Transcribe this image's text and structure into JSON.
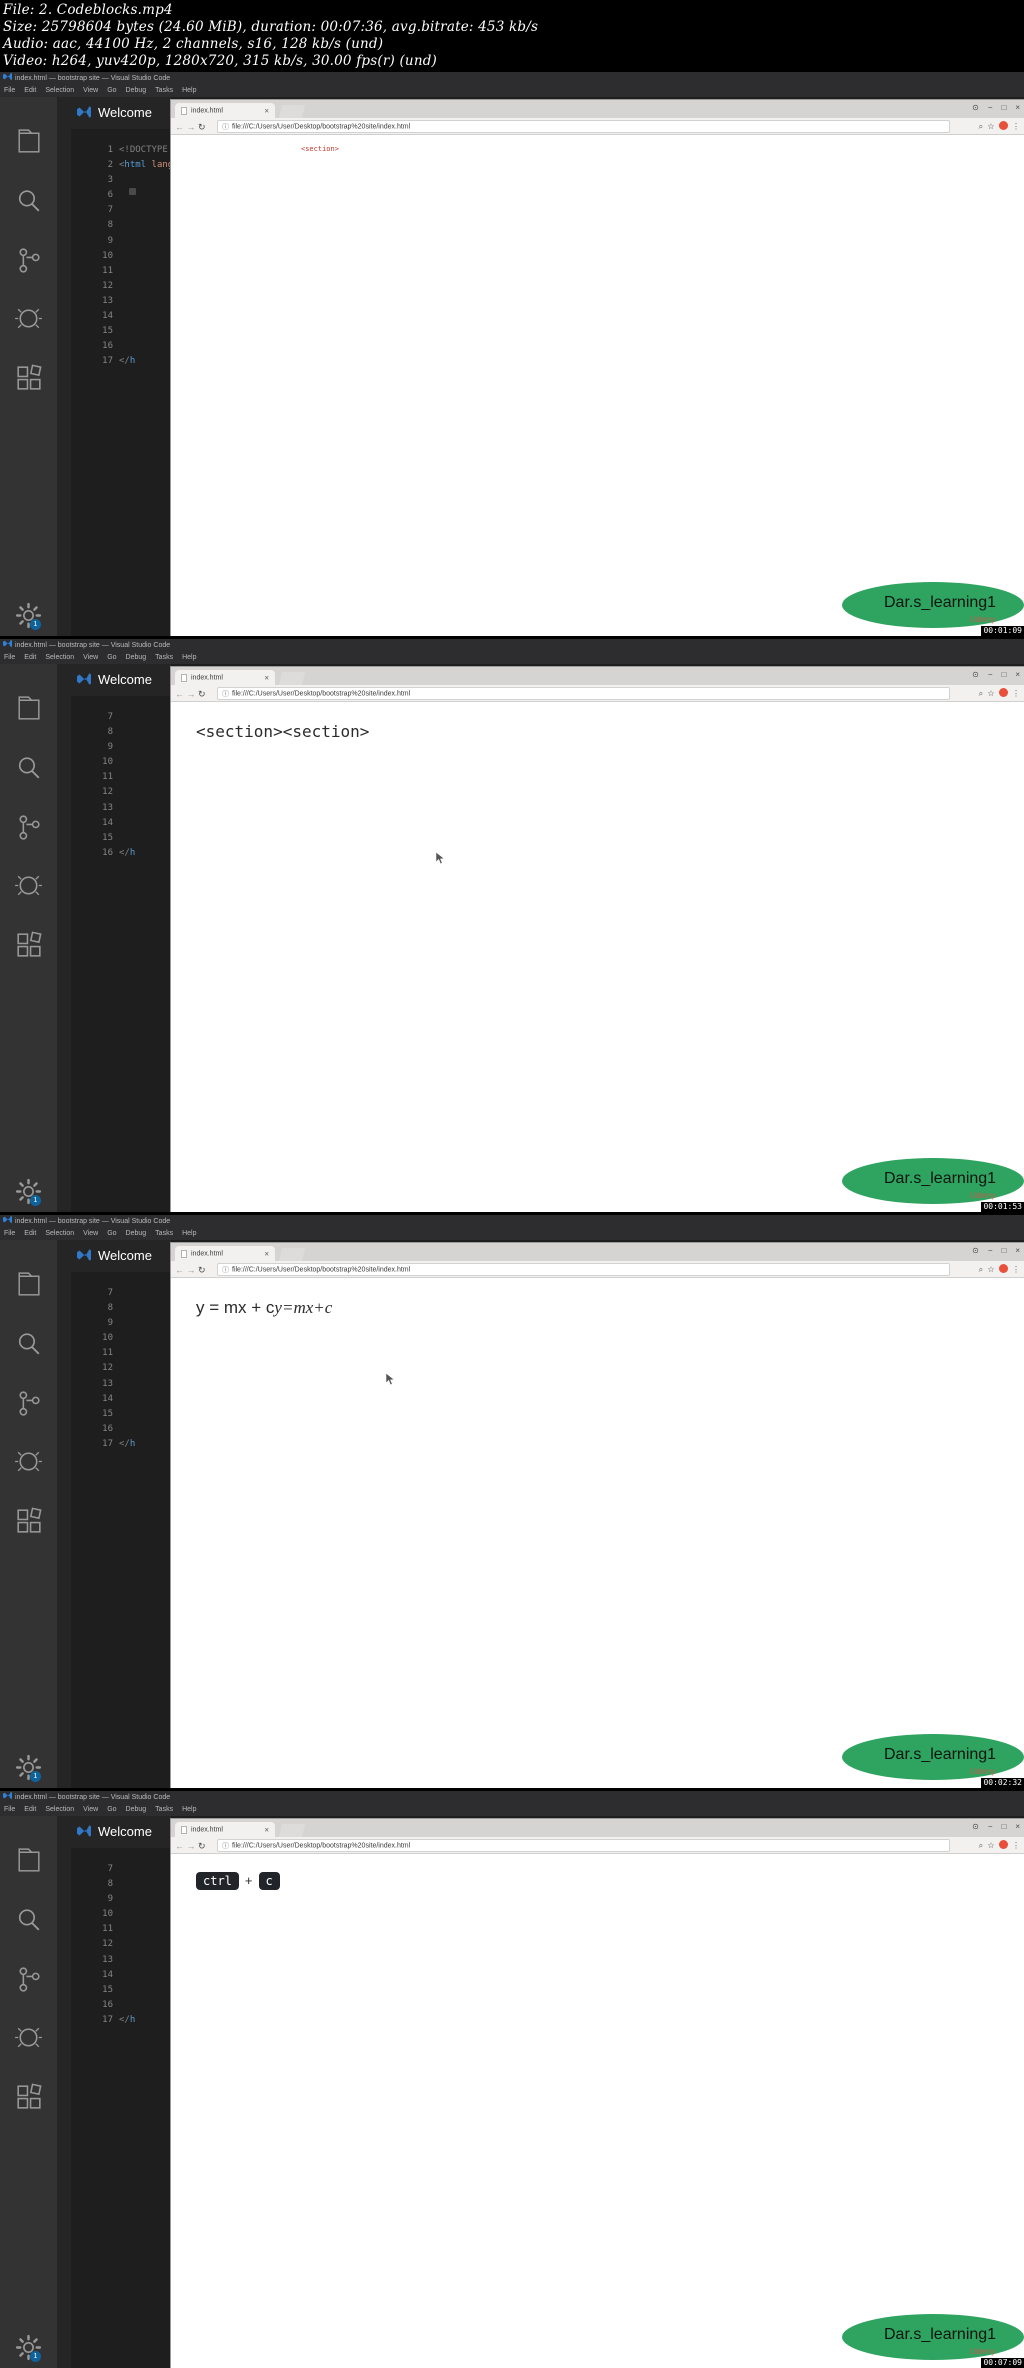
{
  "fileinfo": {
    "line1": "File: 2. Codeblocks.mp4",
    "line2": "Size: 25798604 bytes (24.60 MiB), duration: 00:07:36, avg.bitrate: 453 kb/s",
    "line3": "Audio: aac, 44100 Hz, 2 channels, s16, 128 kb/s (und)",
    "line4": "Video: h264, yuv420p, 1280x720, 315 kb/s, 30.00 fps(r) (und)"
  },
  "vscode": {
    "title": "index.html — bootstrap site — Visual Studio Code",
    "menu": [
      "File",
      "Edit",
      "Selection",
      "View",
      "Go",
      "Debug",
      "Tasks",
      "Help"
    ],
    "tab_label": "Welcome",
    "activity_icons": [
      "explorer-icon",
      "search-icon",
      "source-control-icon",
      "run-debug-icon",
      "extensions-icon",
      "settings-gear-icon"
    ],
    "settings_badge": "1"
  },
  "browser": {
    "tab_title": "index.html",
    "tab_close": "×",
    "url": "file:///C:/Users/User/Desktop/bootstrap%20site/index.html",
    "info_icon": "ⓘ",
    "back": "←",
    "forward": "→",
    "reload": "↻",
    "window_buttons": [
      "⊙",
      "−",
      "□",
      "×"
    ],
    "star_icon": "☆",
    "search_icon": "⌕",
    "block_badge": "⊘"
  },
  "badge": {
    "label": "Dar.s_learning1",
    "udemy": "Udemy",
    "color": "#2fa360"
  },
  "panels": [
    {
      "id": "panel-1",
      "timestamp": "00:01:09",
      "gutter": [
        "1",
        "2",
        "3",
        "6",
        "7",
        "8",
        "9",
        "10",
        "11",
        "12",
        "13",
        "14",
        "15",
        "16",
        "17"
      ],
      "code": [
        "<!DOCTYPE html>",
        "<html lang=\"en\">",
        "",
        "",
        "",
        "",
        "",
        "",
        "",
        "",
        "",
        "",
        "",
        "",
        "</html>"
      ],
      "page_content_type": "code-html",
      "page_text": "<section>",
      "page_text_color": "#c0392b"
    },
    {
      "id": "panel-2",
      "timestamp": "00:01:53",
      "gutter": [
        "7",
        "8",
        "9",
        "10",
        "11",
        "12",
        "13",
        "14",
        "15",
        "16"
      ],
      "code": [
        "",
        "",
        "",
        "",
        "",
        "",
        "",
        "",
        "",
        "</html>"
      ],
      "page_content_type": "section-text",
      "page_text": "<section><section>",
      "page_text_color": "#2b2b2b"
    },
    {
      "id": "panel-3",
      "timestamp": "00:02:32",
      "gutter": [
        "7",
        "8",
        "9",
        "10",
        "11",
        "12",
        "13",
        "14",
        "15",
        "16",
        "17"
      ],
      "code": [
        "",
        "",
        "",
        "",
        "",
        "",
        "",
        "",
        "",
        "",
        "</html>"
      ],
      "page_content_type": "math",
      "page_text": "y = mx + c",
      "page_text_italic": "y=mx+c"
    },
    {
      "id": "panel-4",
      "timestamp": "00:07:09",
      "gutter": [
        "7",
        "8",
        "9",
        "10",
        "11",
        "12",
        "13",
        "14",
        "15",
        "16",
        "17"
      ],
      "code": [
        "",
        "",
        "",
        "",
        "",
        "",
        "",
        "",
        "",
        "",
        "</html>"
      ],
      "page_content_type": "kbd",
      "kbd_first": "ctrl",
      "kbd_plus": "+",
      "kbd_second": "c"
    }
  ]
}
